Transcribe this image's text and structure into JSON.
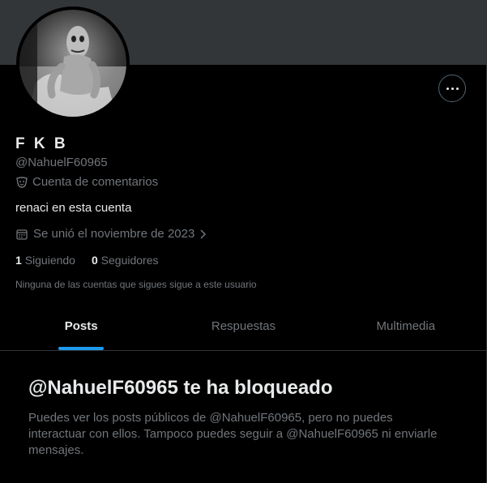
{
  "profile": {
    "display_name": "F K B",
    "handle": "@NahuelF60965",
    "category_icon": "theater-masks-icon",
    "category": "Cuenta de comentarios",
    "bio": "renaci en esta cuenta",
    "joined_icon": "calendar-icon",
    "joined": "Se unió el noviembre de 2023",
    "following_count": "1",
    "following_label": "Siguiendo",
    "followers_count": "0",
    "followers_label": "Seguidores",
    "followers_note": "Ninguna de las cuentas que sigues sigue a este usuario",
    "more_icon": "more-horizontal-icon"
  },
  "tabs": [
    {
      "label": "Posts",
      "active": true
    },
    {
      "label": "Respuestas",
      "active": false
    },
    {
      "label": "Multimedia",
      "active": false
    }
  ],
  "blocked": {
    "title": "@NahuelF60965 te ha bloqueado",
    "message": "Puedes ver los posts públicos de @NahuelF60965, pero no puedes interactuar con ellos. Tampoco puedes seguir a @NahuelF60965 ni enviarle mensajes."
  },
  "colors": {
    "background": "#000000",
    "banner": "#333639",
    "text_primary": "#e7e9ea",
    "text_secondary": "#71767b",
    "accent": "#1d9bf0",
    "border": "#2f3336"
  }
}
